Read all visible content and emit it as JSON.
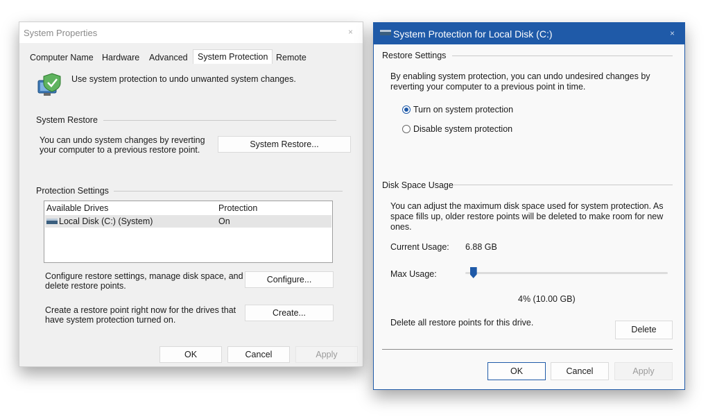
{
  "system_properties": {
    "title": "System Properties",
    "close_glyph": "×",
    "tabs": [
      "Computer Name",
      "Hardware",
      "Advanced",
      "System Protection",
      "Remote"
    ],
    "active_tab": "System Protection",
    "intro": "Use system protection to undo unwanted system changes.",
    "system_restore": {
      "group_label": "System Restore",
      "description_line1": "You can undo system changes by reverting",
      "description_line2": "your computer to a previous restore point.",
      "button": "System Restore..."
    },
    "protection_settings": {
      "group_label": "Protection Settings",
      "columns": [
        "Available Drives",
        "Protection"
      ],
      "rows": [
        {
          "drive": "Local Disk (C:) (System)",
          "protection": "On"
        }
      ],
      "configure_line1": "Configure restore settings, manage disk space, and",
      "configure_line2": "delete restore points.",
      "configure_button": "Configure...",
      "create_line1": "Create a restore point right now for the drives that",
      "create_line2": "have system protection turned on.",
      "create_button": "Create..."
    },
    "footer": {
      "ok": "OK",
      "cancel": "Cancel",
      "apply": "Apply"
    }
  },
  "protection_dialog": {
    "title": "System Protection for Local Disk (C:)",
    "close_glyph": "×",
    "restore_settings": {
      "group_label": "Restore Settings",
      "description_line1": "By enabling system protection, you can undo undesired changes by",
      "description_line2": "reverting your computer to a previous point in time.",
      "options": [
        {
          "label": "Turn on system protection",
          "selected": true
        },
        {
          "label": "Disable system protection",
          "selected": false
        }
      ]
    },
    "disk_space": {
      "group_label": "Disk Space Usage",
      "description_line1": "You can adjust the maximum disk space used for system protection. As",
      "description_line2": "space fills up, older restore points will be deleted to make room for new",
      "description_line3": "ones.",
      "current_usage_label": "Current Usage:",
      "current_usage_value": "6.88 GB",
      "max_usage_label": "Max Usage:",
      "max_usage_percent": 4,
      "max_usage_readout": "4% (10.00 GB)",
      "delete_text": "Delete all restore points for this drive.",
      "delete_button": "Delete"
    },
    "footer": {
      "ok": "OK",
      "cancel": "Cancel",
      "apply": "Apply"
    },
    "colors": {
      "accent": "#1f5aa8"
    }
  }
}
